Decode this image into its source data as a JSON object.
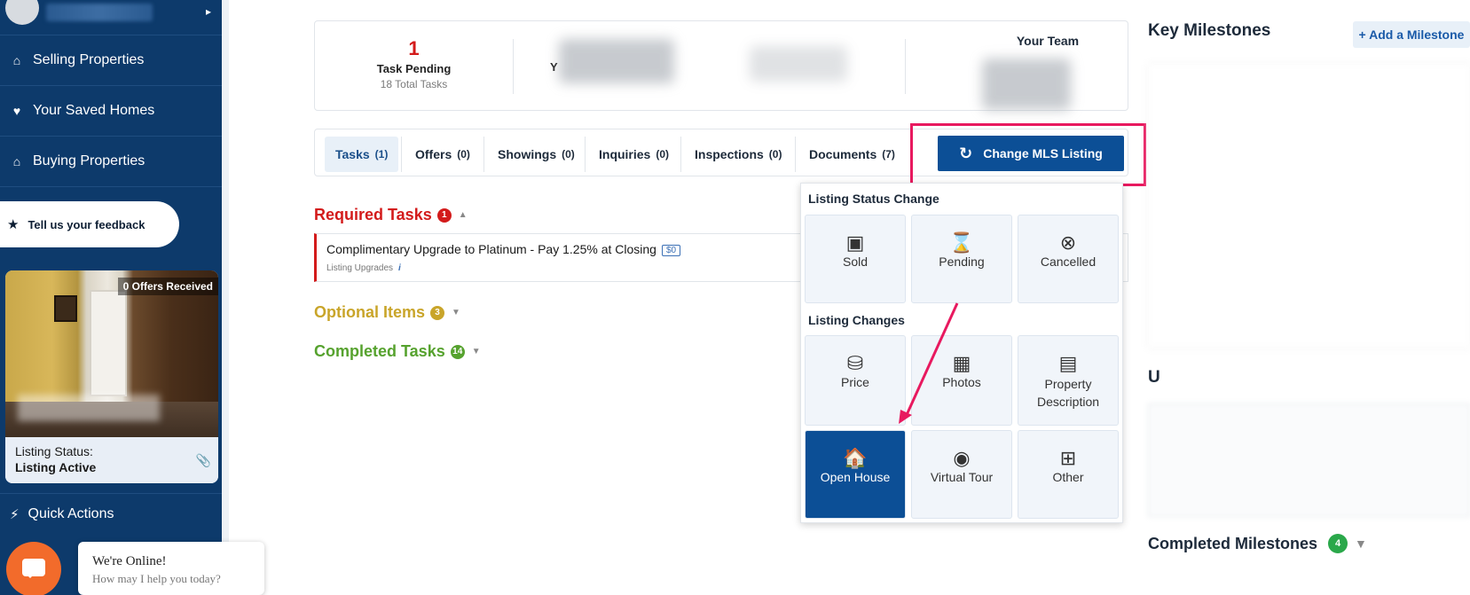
{
  "sidebar": {
    "nav": [
      {
        "label": "Selling Properties",
        "icon": "home-icon"
      },
      {
        "label": "Your Saved Homes",
        "icon": "heart-icon"
      },
      {
        "label": "Buying Properties",
        "icon": "home-icon"
      }
    ],
    "feedback_label": "Tell us your feedback",
    "listing": {
      "offers_badge": "0 Offers Received",
      "status_label": "Listing Status:",
      "status_value": "Listing Active"
    },
    "quick_actions_label": "Quick Actions"
  },
  "chat": {
    "title": "We're Online!",
    "subtitle": "How may I help you today?"
  },
  "stats": {
    "task_pending_count": "1",
    "task_pending_label": "Task Pending",
    "total_tasks": "18 Total Tasks",
    "your_team_label": "Your Team",
    "partial_letter": "Y"
  },
  "tabs": [
    {
      "label": "Tasks",
      "count": "(1)"
    },
    {
      "label": "Offers",
      "count": "(0)"
    },
    {
      "label": "Showings",
      "count": "(0)"
    },
    {
      "label": "Inquiries",
      "count": "(0)"
    },
    {
      "label": "Inspections",
      "count": "(0)"
    },
    {
      "label": "Documents",
      "count": "(7)"
    }
  ],
  "change_mls_label": "Change MLS Listing",
  "sections": {
    "required": {
      "title": "Required Tasks",
      "count": "1"
    },
    "optional": {
      "title": "Optional Items",
      "count": "3"
    },
    "completed": {
      "title": "Completed Tasks",
      "count": "14"
    }
  },
  "task": {
    "title": "Complimentary Upgrade to Platinum - Pay 1.25% at Closing",
    "price_tag": "$0",
    "subtitle": "Listing Upgrades",
    "info": "i"
  },
  "menu": {
    "status_heading": "Listing Status Change",
    "status_options": [
      {
        "label": "Sold",
        "icon": "sold-sign-icon"
      },
      {
        "label": "Pending",
        "icon": "hourglass-sign-icon"
      },
      {
        "label": "Cancelled",
        "icon": "cancelled-sign-icon"
      }
    ],
    "changes_heading": "Listing Changes",
    "change_options": [
      {
        "label": "Price",
        "icon": "coins-icon"
      },
      {
        "label": "Photos",
        "icon": "photo-icon"
      },
      {
        "label": "Property Description",
        "icon": "document-icon"
      },
      {
        "label": "Open House",
        "icon": "calendar-house-icon"
      },
      {
        "label": "Virtual Tour",
        "icon": "virtual-tour-icon"
      },
      {
        "label": "Other",
        "icon": "grid-icon"
      }
    ]
  },
  "right_panel": {
    "key_milestones_title": "Key Milestones",
    "add_milestone_label": "+ Add a Milestone",
    "partial_letter": "U",
    "completed_milestones_title": "Completed Milestones",
    "completed_milestones_count": "4"
  },
  "colors": {
    "sidebar_bg": "#0d3a6b",
    "primary": "#0c4f96",
    "required_red": "#d31b1b",
    "optional_gold": "#c9a52a",
    "completed_green": "#56a22e",
    "highlight_pink": "#e8195f"
  }
}
